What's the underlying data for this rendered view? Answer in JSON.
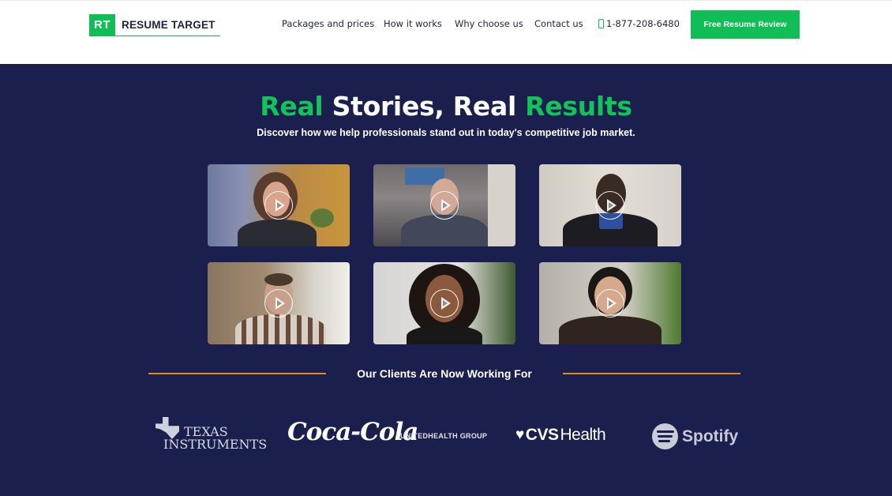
{
  "header": {
    "logo_mark": "RT",
    "logo_text": "RESUME TARGET",
    "nav": [
      "Packages and prices",
      "How it works",
      "Why choose us",
      "Contact us"
    ],
    "phone": "1-877-208-6480",
    "cta_label": "Free Resume Review"
  },
  "hero": {
    "title_word1": "Real",
    "title_word2": " Stories, Real ",
    "title_word3": "Results",
    "subtitle": "Discover how we help professionals stand out in today's competitive job market."
  },
  "videos": [
    {
      "name": "testimonial-video-1"
    },
    {
      "name": "testimonial-video-2"
    },
    {
      "name": "testimonial-video-3"
    },
    {
      "name": "testimonial-video-4"
    },
    {
      "name": "testimonial-video-5"
    },
    {
      "name": "testimonial-video-6"
    }
  ],
  "clients": {
    "title": "Our Clients Are Now Working For",
    "logos": {
      "ti_line1": "TEXAS",
      "ti_line2": "INSTRUMENTS",
      "coke": "Coca-Cola",
      "uhg": "UNITEDHEALTH GROUP",
      "cvs_bold": "CVS",
      "cvs_light": "Health",
      "spotify": "Spotify"
    }
  },
  "colors": {
    "brand_green": "#0fbf56",
    "navy": "#1a1f4d",
    "divider_orange": "#e08a22"
  }
}
